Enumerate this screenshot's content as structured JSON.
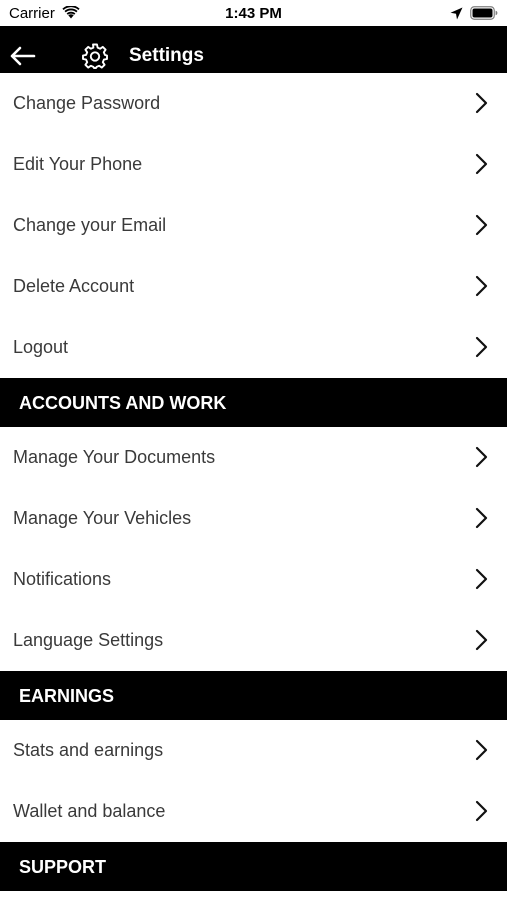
{
  "status_bar": {
    "carrier": "Carrier",
    "time": "1:43 PM"
  },
  "nav": {
    "title": "Settings"
  },
  "groups": [
    {
      "header": "",
      "items": [
        {
          "label": "Change Password"
        },
        {
          "label": "Edit Your Phone"
        },
        {
          "label": "Change your Email"
        },
        {
          "label": "Delete Account"
        },
        {
          "label": "Logout"
        }
      ]
    },
    {
      "header": "ACCOUNTS AND WORK",
      "items": [
        {
          "label": "Manage Your Documents"
        },
        {
          "label": "Manage Your Vehicles"
        },
        {
          "label": "Notifications"
        },
        {
          "label": "Language Settings"
        }
      ]
    },
    {
      "header": "EARNINGS",
      "items": [
        {
          "label": "Stats and earnings"
        },
        {
          "label": "Wallet and balance"
        }
      ]
    },
    {
      "header": "SUPPORT",
      "items": []
    }
  ],
  "colors": {
    "nav_background": "#000000",
    "section_header_background": "#000000",
    "row_text": "#3a3a3a"
  }
}
